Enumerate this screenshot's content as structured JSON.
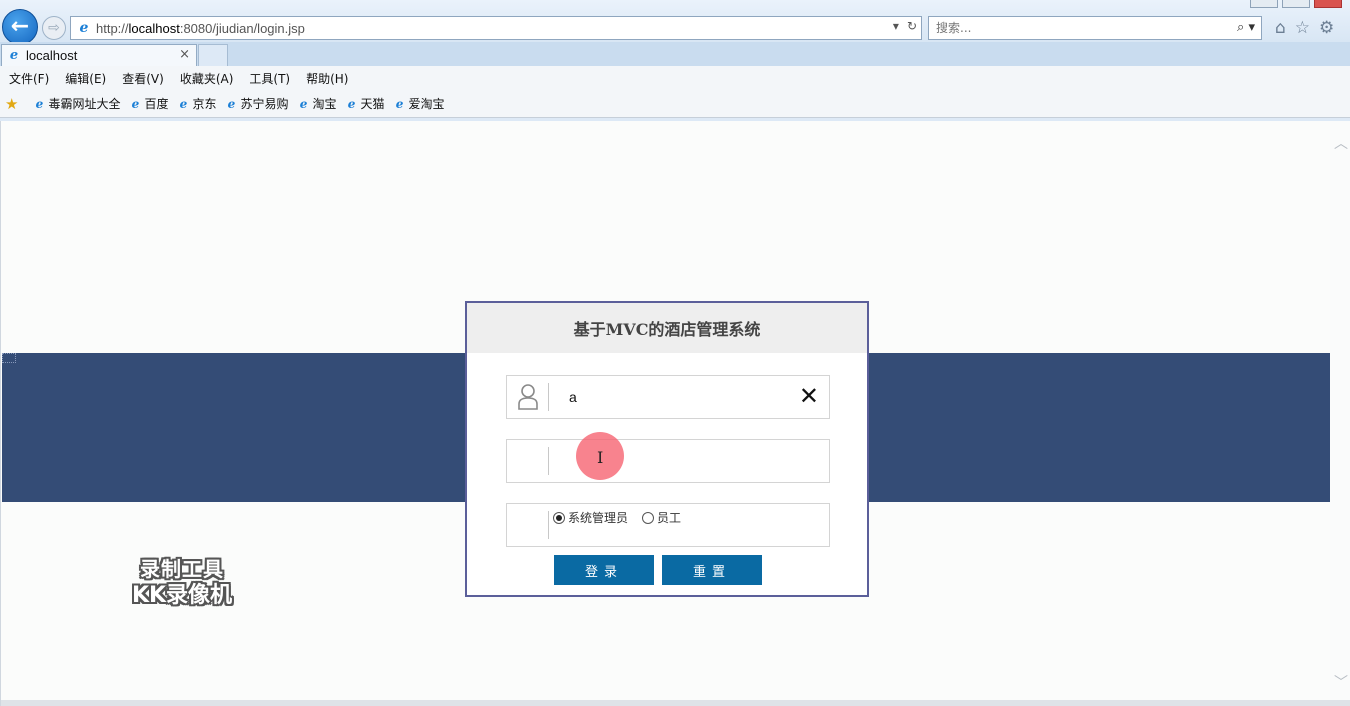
{
  "browser": {
    "url_prefix": "http://",
    "url_host": "localhost",
    "url_rest": ":8080/jiudian/login.jsp",
    "search_placeholder": "搜索...",
    "tab_title": "localhost",
    "tab_close": "×",
    "menu": [
      "文件(F)",
      "编辑(E)",
      "查看(V)",
      "收藏夹(A)",
      "工具(T)",
      "帮助(H)"
    ],
    "favorites": [
      "毒霸网址大全",
      "百度",
      "京东",
      "苏宁易购",
      "淘宝",
      "天猫",
      "爱淘宝"
    ]
  },
  "login": {
    "title": "基于MVC的酒店管理系统",
    "username_value": "a",
    "password_value": "",
    "role_options": [
      "系统管理员",
      "员工"
    ],
    "selected_role": "系统管理员",
    "login_button": "登录",
    "reset_button": "重置"
  },
  "watermark": {
    "line1": "录制工具",
    "line2": "KK录像机"
  },
  "colors": {
    "banner": "#344c76",
    "button": "#0a6aa3",
    "dialog_border": "#5b5f9a"
  }
}
